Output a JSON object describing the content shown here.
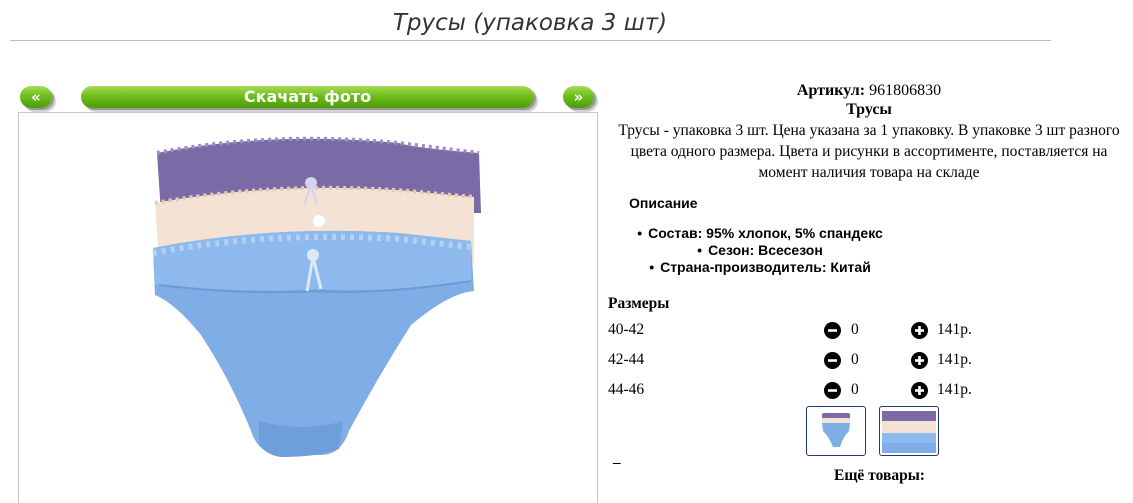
{
  "page": {
    "title": "Трусы (упаковка 3 шт)"
  },
  "gallery": {
    "prev_label": "«",
    "download_label": "Скачать фото",
    "next_label": "»"
  },
  "product": {
    "sku_label": "Артикул:",
    "sku_value": "961806830",
    "name": "Трусы",
    "description": "Трусы - упаковка 3 шт. Цена указана за 1 упаковку. В упаковке 3 шт разного цвета одного размера. Цвета и рисунки в ассортименте, поставляется на момент наличия товара на складе",
    "details_title": "Описание",
    "specs": [
      "Состав: 95% хлопок, 5% спандекс",
      "Сезон: Всесезон",
      "Страна-производитель: Китай"
    ]
  },
  "sizes": {
    "title": "Размеры",
    "rows": [
      {
        "label": "40-42",
        "qty": "0",
        "price": "141р."
      },
      {
        "label": "42-44",
        "qty": "0",
        "price": "141р."
      },
      {
        "label": "44-46",
        "qty": "0",
        "price": "141р."
      }
    ]
  },
  "footer": {
    "marker": "–",
    "more_title": "Ещё товары:"
  },
  "colors": {
    "button_green": "#6fbe1c",
    "lace_purple": "#7a6aa6",
    "lace_cream": "#f4e3d4",
    "fabric_blue": "#7faee6",
    "thumb_border": "#1e3a6e"
  },
  "icons": [
    "minus-circle-icon",
    "plus-circle-icon"
  ]
}
